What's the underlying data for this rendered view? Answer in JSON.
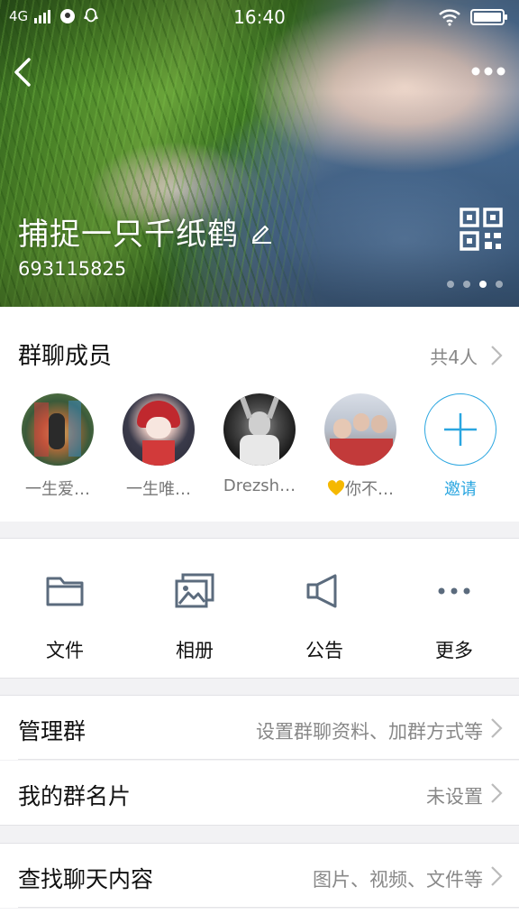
{
  "status_bar": {
    "network": "4G",
    "time": "16:40"
  },
  "header": {
    "group_name": "捕捉一只千纸鹤",
    "group_id": "693115825",
    "icons": [
      "back-icon",
      "more-icon",
      "edit-icon",
      "qr-code-icon"
    ]
  },
  "members": {
    "title": "群聊成员",
    "count": "共4人",
    "list": [
      {
        "name": "一生爱…"
      },
      {
        "name": "一生唯…"
      },
      {
        "name": "Drezsh…"
      },
      {
        "name": "你不…"
      }
    ],
    "invite_label": "邀请"
  },
  "shortcuts": [
    {
      "label": "文件",
      "icon": "folder-icon"
    },
    {
      "label": "相册",
      "icon": "album-icon"
    },
    {
      "label": "公告",
      "icon": "megaphone-icon"
    },
    {
      "label": "更多",
      "icon": "more-dots-icon"
    }
  ],
  "rows": {
    "manage": {
      "label": "管理群",
      "value": "设置群聊资料、加群方式等"
    },
    "card": {
      "label": "我的群名片",
      "value": "未设置"
    },
    "search": {
      "label": "查找聊天内容",
      "value": "图片、视频、文件等"
    }
  },
  "colors": {
    "accent": "#2aa6e0",
    "icon_gray": "#5b6b7d",
    "heart": "#f5b800"
  }
}
